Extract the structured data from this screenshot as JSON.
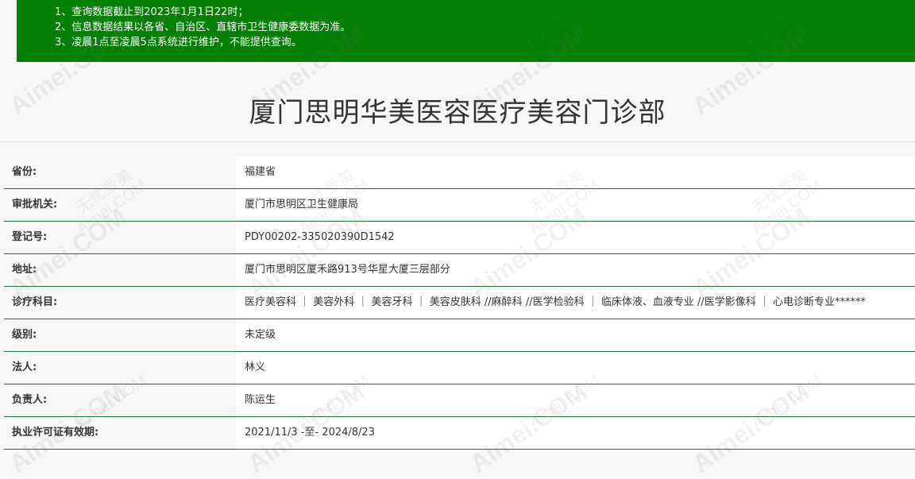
{
  "notice": {
    "lines": [
      "1、查询数据截止到2023年1月1日22时；",
      "2、信息数据结果以各省、自治区、直辖市卫生健康委数据为准。",
      "3、凌晨1点至凌晨5点系统进行维护，不能提供查询。"
    ]
  },
  "page": {
    "title": "厦门思明华美医容医疗美容门诊部"
  },
  "records": [
    {
      "label": "省份:",
      "value": "福建省"
    },
    {
      "label": "审批机关:",
      "value": "厦门市思明区卫生健康局"
    },
    {
      "label": "登记号:",
      "value": "PDY00202-335020390D1542"
    },
    {
      "label": "地址:",
      "value": "厦门市思明区厦禾路913号华星大厦三层部分"
    },
    {
      "label": "诊疗科目:",
      "value": "医疗美容科 ｜ 美容外科 ｜ 美容牙科 ｜ 美容皮肤科 //麻醉科 //医学检验科 ｜ 临床体液、血液专业 //医学影像科 ｜ 心电诊断专业******"
    },
    {
      "label": "级别:",
      "value": "未定级"
    },
    {
      "label": "法人:",
      "value": "林义"
    },
    {
      "label": "负责人:",
      "value": "陈运生"
    },
    {
      "label": "执业许可证有效期:",
      "value": "2021/11/3 -至- 2024/8/23"
    }
  ],
  "watermark": {
    "text": "Aimei.COM",
    "subtext": "无忧爱美"
  }
}
